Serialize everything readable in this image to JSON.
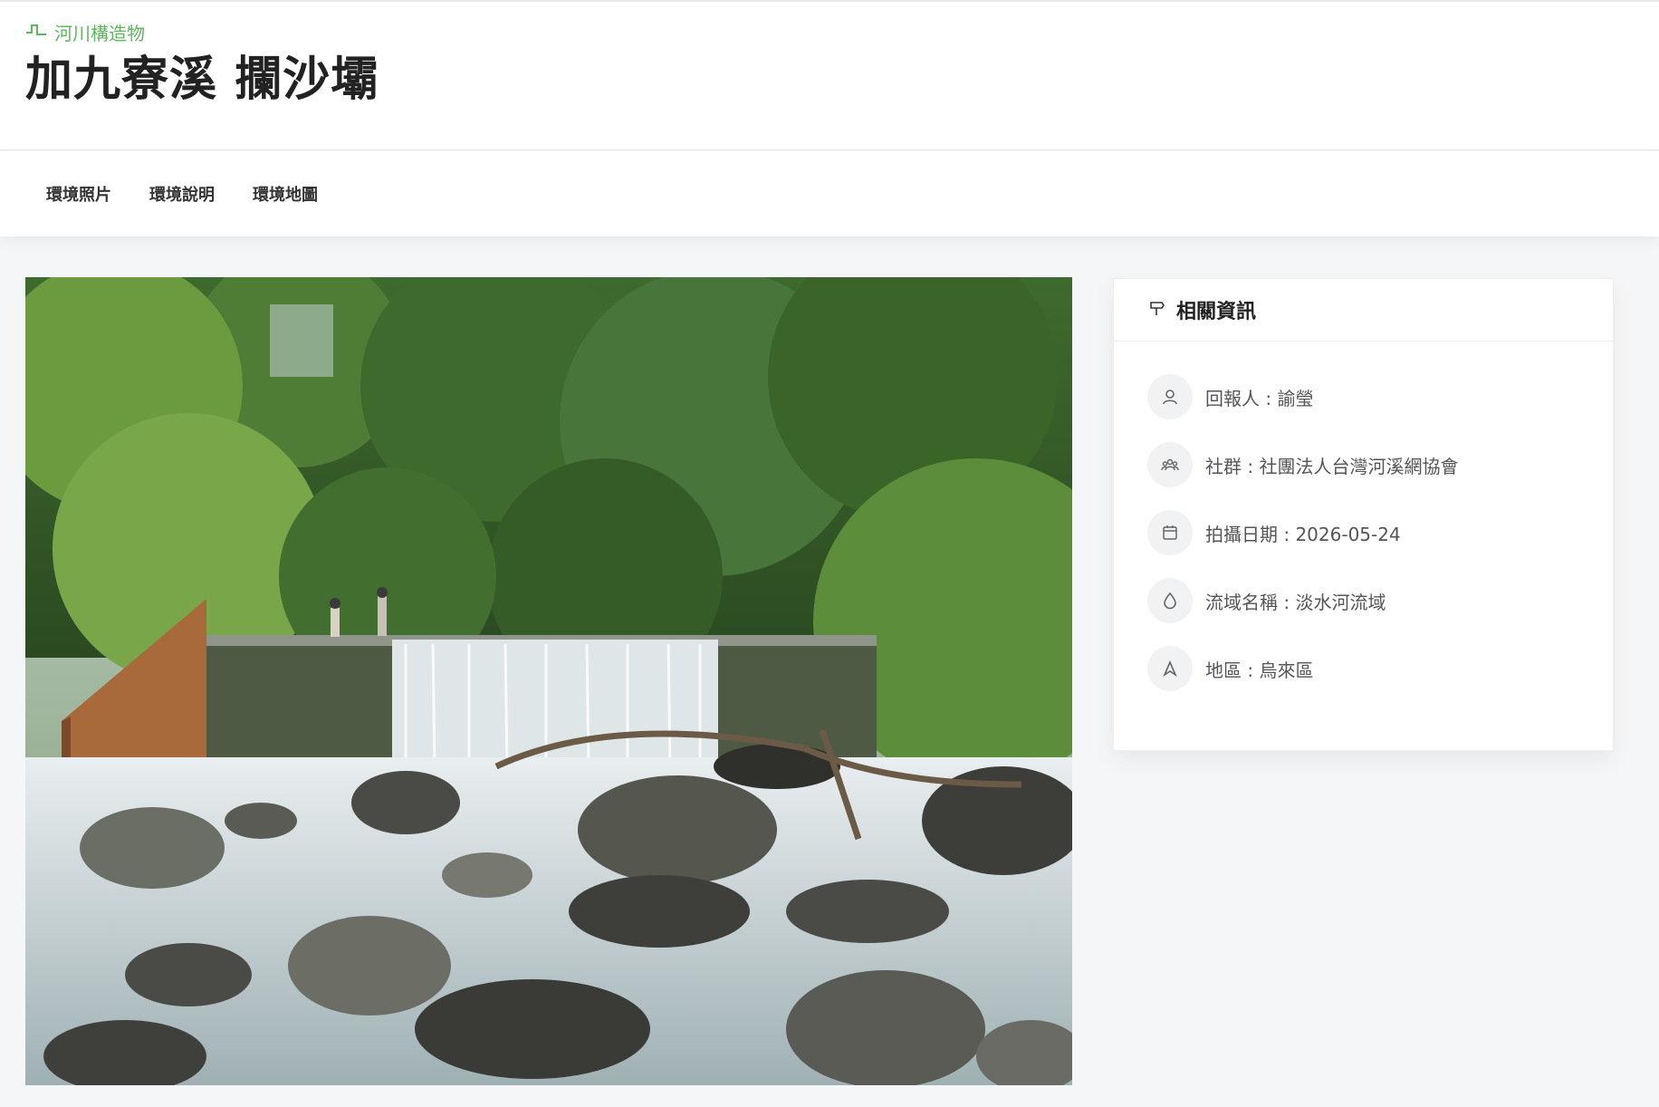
{
  "header": {
    "category_icon": "river-structure-icon",
    "category": "河川構造物",
    "title": "加九寮溪 攔沙壩"
  },
  "tabs": [
    {
      "label": "環境照片"
    },
    {
      "label": "環境說明"
    },
    {
      "label": "環境地圖"
    }
  ],
  "photo": {
    "subject": "攔沙壩"
  },
  "info_card": {
    "title": "相關資訊",
    "title_icon": "signpost-icon",
    "items": [
      {
        "icon": "user-icon",
        "text": "回報人 : 諭瑩"
      },
      {
        "icon": "community-icon",
        "text": "社群 : 社團法人台灣河溪網協會"
      },
      {
        "icon": "calendar-icon",
        "text": "拍攝日期 : 2026-05-24"
      },
      {
        "icon": "water-drop-icon",
        "text": "流域名稱 : 淡水河流域"
      },
      {
        "icon": "location-icon",
        "text": "地區 : 烏來區"
      }
    ]
  },
  "colors": {
    "accent": "#5cb85c",
    "background": "#f5f6f8",
    "card": "#ffffff"
  }
}
